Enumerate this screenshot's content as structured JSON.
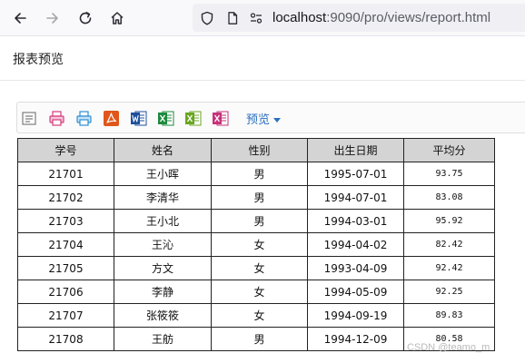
{
  "browser": {
    "url_host": "localhost",
    "url_rest": ":9090/pro/views/report.html"
  },
  "page": {
    "title": "报表预览"
  },
  "toolbar": {
    "icons": [
      "print-layout-icon",
      "print-icon",
      "print-setup-icon",
      "pdf-icon",
      "word-icon",
      "excel-icon",
      "excel-alt-icon",
      "excel-export-icon"
    ],
    "preview_label": "预览"
  },
  "table": {
    "headers": [
      "学号",
      "姓名",
      "性别",
      "出生日期",
      "平均分"
    ],
    "rows": [
      [
        "21701",
        "王小晖",
        "男",
        "1995-07-01",
        "93.75"
      ],
      [
        "21702",
        "李清华",
        "男",
        "1994-07-01",
        "83.08"
      ],
      [
        "21703",
        "王小北",
        "男",
        "1994-03-01",
        "95.92"
      ],
      [
        "21704",
        "王沁",
        "女",
        "1994-04-02",
        "82.42"
      ],
      [
        "21705",
        "方文",
        "女",
        "1993-04-09",
        "92.42"
      ],
      [
        "21706",
        "李静",
        "女",
        "1994-05-09",
        "92.25"
      ],
      [
        "21707",
        "张筱筱",
        "女",
        "1994-09-19",
        "89.83"
      ],
      [
        "21708",
        "王舫",
        "男",
        "1994-12-09",
        "80.58"
      ]
    ]
  },
  "watermark": "CSDN @teamo_m"
}
